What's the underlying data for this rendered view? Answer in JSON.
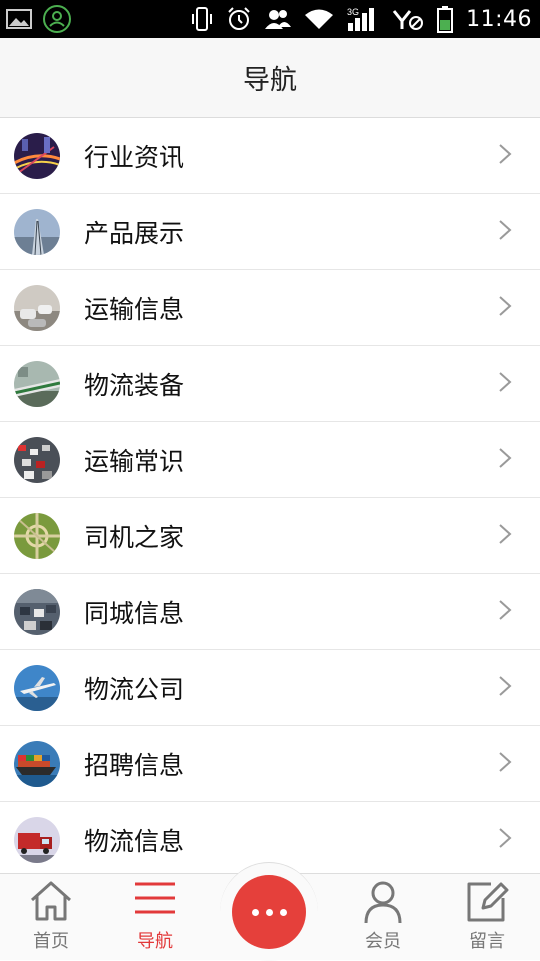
{
  "status_bar": {
    "time": "11:46",
    "network_label": "3G",
    "icons": [
      "image-icon",
      "contact-icon",
      "vibrate-icon",
      "alarm-icon",
      "people-icon",
      "wifi-icon",
      "signal-icon",
      "no-sim-icon",
      "battery-icon"
    ]
  },
  "header": {
    "title": "导航"
  },
  "nav": {
    "items": [
      {
        "label": "行业资讯",
        "thumb": "night-highway"
      },
      {
        "label": "产品展示",
        "thumb": "railway-bridge"
      },
      {
        "label": "运输信息",
        "thumb": "traffic-road"
      },
      {
        "label": "物流装备",
        "thumb": "train-station"
      },
      {
        "label": "运输常识",
        "thumb": "traffic-jam"
      },
      {
        "label": "司机之家",
        "thumb": "highway-interchange"
      },
      {
        "label": "同城信息",
        "thumb": "city-traffic"
      },
      {
        "label": "物流公司",
        "thumb": "airplane"
      },
      {
        "label": "招聘信息",
        "thumb": "cargo-ship"
      },
      {
        "label": "物流信息",
        "thumb": "red-truck"
      }
    ]
  },
  "tabbar": {
    "home": "首页",
    "nav": "导航",
    "member": "会员",
    "message": "留言"
  },
  "colors": {
    "accent": "#e2393a",
    "status_bar": "#000000",
    "header_bg": "#f7f7f7"
  }
}
